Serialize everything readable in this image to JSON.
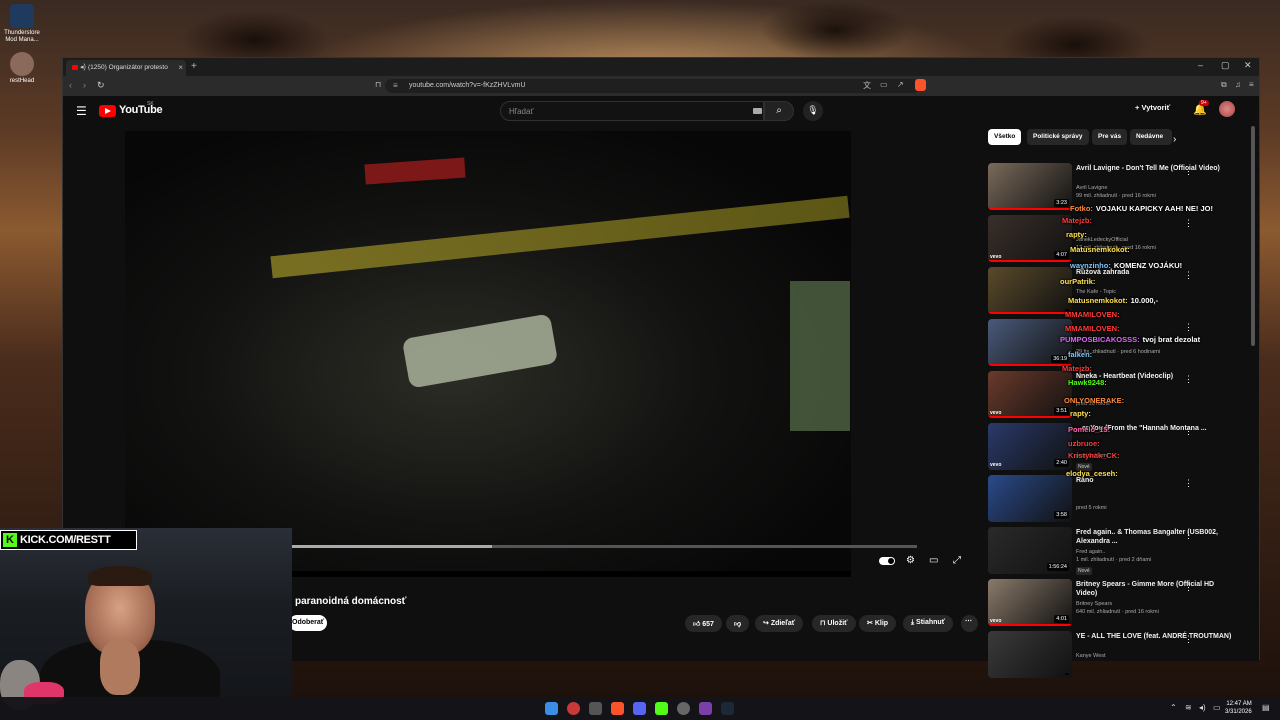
{
  "desktop": {
    "icons": [
      {
        "label": "Thunderstore Mod Mana..."
      },
      {
        "label": "restHead"
      }
    ]
  },
  "browser": {
    "tab_title": "(1250) Organizátor protesto",
    "url": "youtube.com/watch?v=-fKzZHVLvmU"
  },
  "youtube": {
    "logo_text": "YouTube",
    "region": "SK",
    "search_placeholder": "Hľadať",
    "create_label": "Vytvoriť",
    "notif_count": "9+",
    "video": {
      "title": "paranoidná domácnosť",
      "progress_fraction": 0.38,
      "subscribe_label": "Odoberať",
      "likes": "657",
      "share_label": "Zdieľať",
      "save_label": "Uložiť",
      "clip_label": "Klip",
      "download_label": "Stiahnuť"
    },
    "chips": [
      {
        "label": "Všetko",
        "active": true
      },
      {
        "label": "Politické správy",
        "active": false
      },
      {
        "label": "Pre vás",
        "active": false
      },
      {
        "label": "Nedávne",
        "active": false
      }
    ],
    "recommendations": [
      {
        "title": "Avril Lavigne - Don't Tell Me (Official Video)",
        "channel": "Avril Lavigne",
        "meta": "99 mil. zhliadnutí · pred 16 rokmi",
        "duration": "3:23",
        "vevo": "",
        "new": ""
      },
      {
        "title": "",
        "channel": "JanekLedeckyOfficial",
        "meta": "17 mil. zhliadnutí · pred 16 rokmi",
        "duration": "4:07",
        "vevo": "vevo",
        "new": ""
      },
      {
        "title": "Růžová zahrada",
        "channel": "The Kafe - Topic",
        "meta": "",
        "duration": "",
        "vevo": "",
        "new": ""
      },
      {
        "title": "",
        "channel": "",
        "meta": "29 tis. zhliadnutí · pred 6 hodinami",
        "duration": "36:19",
        "vevo": "",
        "new": ""
      },
      {
        "title": "Nneka - Heartbeat (Videoclip)",
        "channel": "",
        "meta": "pred 16 rokmi",
        "duration": "3:51",
        "vevo": "vevo",
        "new": ""
      },
      {
        "title": "...er You (From the \"Hannah Montana ...",
        "channel": "",
        "meta": "pred 3 dňami",
        "duration": "2:40",
        "vevo": "vevo",
        "new": "Nové"
      },
      {
        "title": "Ráno",
        "channel": "",
        "meta": "pred 5 rokmi",
        "duration": "3:58",
        "vevo": "",
        "new": ""
      },
      {
        "title": "Fred again.. & Thomas Bangalter (USB002, Alexandra ...",
        "channel": "Fred again..",
        "meta": "1 mil. zhliadnutí · pred 2 dňami",
        "duration": "1:56:24",
        "vevo": "",
        "new": "Nové"
      },
      {
        "title": "Britney Spears - Gimme More (Official HD Video)",
        "channel": "Britney Spears",
        "meta": "640 mil. zhliadnutí · pred 16 rokmi",
        "duration": "4:01",
        "vevo": "vevo",
        "new": ""
      },
      {
        "title": "YE - ALL THE LOVE (feat. ANDRÉ TROUTMAN)",
        "channel": "Kanye West",
        "meta": "",
        "duration": "",
        "vevo": "",
        "new": ""
      }
    ]
  },
  "chat": [
    {
      "user": "Fotko:",
      "msg": "VOJAKU KAPICKY AAH! NE! JO!",
      "ucolor": "#ff8a3d"
    },
    {
      "user": "Matejzb:",
      "msg": "",
      "ucolor": "#ff3b3b"
    },
    {
      "user": "rapty:",
      "msg": "",
      "ucolor": "#ffe14d"
    },
    {
      "user": "Matusnemkokot:",
      "msg": "",
      "ucolor": "#ffe14d"
    },
    {
      "user": "waynzinho:",
      "msg": "KOMENZ VOJÁKU!",
      "ucolor": "#7dc8ff"
    },
    {
      "user": "ourPatrik:",
      "msg": "",
      "ucolor": "#ffe14d"
    },
    {
      "user": "Matusnemkokot:",
      "msg": "10.000,-",
      "ucolor": "#ffe14d"
    },
    {
      "user": "MMAMILOVEN:",
      "msg": "",
      "ucolor": "#ff3b3b"
    },
    {
      "user": "MMAMILOVEN:",
      "msg": "",
      "ucolor": "#ff3b3b"
    },
    {
      "user": "PUMPOSBICAKOSSS:",
      "msg": "tvoj brat dezolat",
      "ucolor": "#e066ff"
    },
    {
      "user": "falken:",
      "msg": "",
      "ucolor": "#7dc8ff"
    },
    {
      "user": "Matejzb:",
      "msg": "",
      "ucolor": "#ff3b3b"
    },
    {
      "user": "Hawk9248:",
      "msg": "",
      "ucolor": "#53fc18"
    },
    {
      "user": "ONLYONERAKE:",
      "msg": "",
      "ucolor": "#ff8a3d"
    },
    {
      "user": "rapty:",
      "msg": "",
      "ucolor": "#ffe14d"
    },
    {
      "user": "Pomelo_15:",
      "msg": "",
      "ucolor": "#ff66aa"
    },
    {
      "user": "uzbruoe:",
      "msg": "",
      "ucolor": "#ff3b3b"
    },
    {
      "user": "Kristynak_CK:",
      "msg": "",
      "ucolor": "#ff3b3b"
    },
    {
      "user": "elodya_ceseh:",
      "msg": "",
      "ucolor": "#ffe14d"
    }
  ],
  "webcam": {
    "kick_logo": "K",
    "kick_url": "KICK.COM/RESTT"
  },
  "taskbar": {
    "time": "12:47 AM",
    "date": "3/31/2026"
  }
}
